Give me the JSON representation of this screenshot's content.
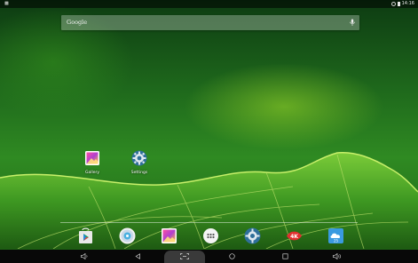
{
  "status_bar": {
    "left_icon": "notification-icon",
    "time": "14:16"
  },
  "search": {
    "label": "Google",
    "mic_icon": "microphone-icon"
  },
  "desktop": {
    "icons": [
      {
        "label": "Gallery",
        "icon": "gallery-icon"
      },
      {
        "label": "Settings",
        "icon": "settings-gear-icon"
      }
    ]
  },
  "dock": {
    "items": [
      {
        "icon": "play-store-icon"
      },
      {
        "icon": "disc-player-icon"
      },
      {
        "icon": "gallery-icon"
      },
      {
        "icon": "app-drawer-icon"
      },
      {
        "icon": "settings-gear-icon"
      },
      {
        "icon": "4k-player-icon"
      },
      {
        "icon": "weather-icon"
      }
    ]
  },
  "nav_bar": {
    "buttons": [
      "volume-down-icon",
      "back-icon",
      "screenshot-icon",
      "home-icon",
      "recents-icon",
      "volume-up-icon"
    ]
  },
  "colors": {
    "accent_green": "#2f8a22",
    "nav_bg": "#080808"
  }
}
